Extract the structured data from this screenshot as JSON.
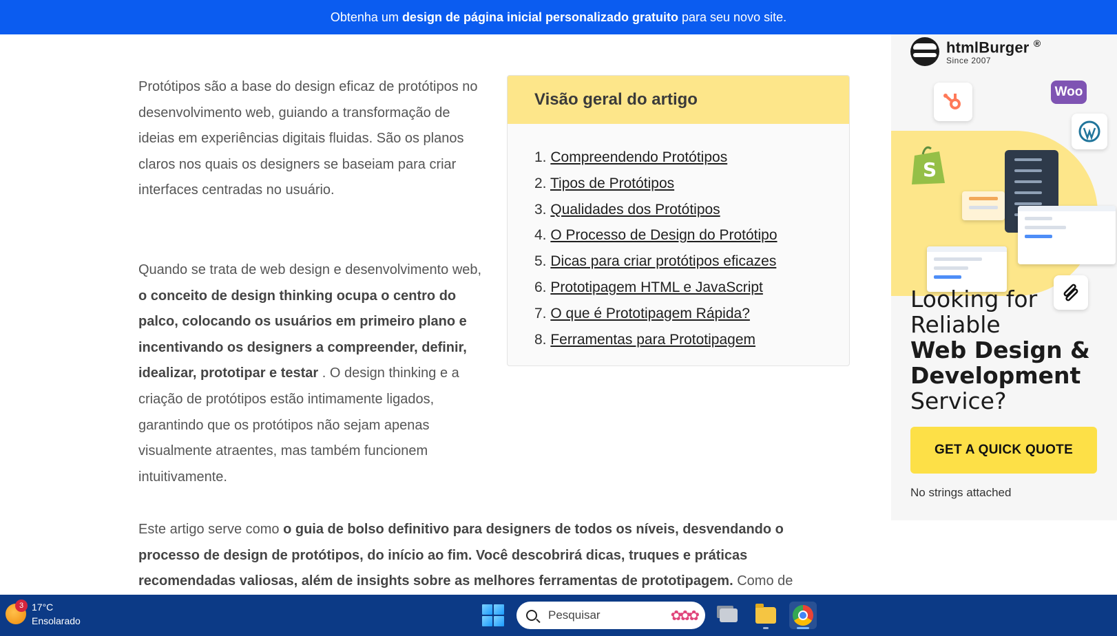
{
  "banner": {
    "prefix": "Obtenha um",
    "bold": "design de página inicial personalizado gratuito",
    "suffix": "para seu novo site."
  },
  "article": {
    "intro": "Protótipos são a base do design eficaz de protótipos no desenvolvimento web, guiando a transformação de ideias em experiências digitais fluidas. São os planos claros nos quais os designers se baseiam para criar interfaces centradas no usuário.",
    "second_start": "Quando se trata de web design e desenvolvimento web,",
    "second_bold": "o conceito de design thinking ocupa o centro do palco, colocando os usuários em primeiro plano e incentivando os designers a compreender, definir, idealizar, prototipar e testar",
    "second_end": ". O design thinking e a criação de protótipos estão intimamente ligados, garantindo que os protótipos não sejam apenas visualmente atraentes, mas também funcionem intuitivamente.",
    "third_start": "Este artigo serve como",
    "third_bold": "o guia de bolso definitivo para designers de todos os níveis, desvendando o processo de design de protótipos, do início ao fim. Você descobrirá dicas, truques e práticas recomendadas valiosas, além de insights sobre as melhores ferramentas de prototipagem.",
    "third_end": "Como de"
  },
  "overview": {
    "title": "Visão geral do artigo",
    "items": [
      {
        "num": "1.",
        "label": "Compreendendo Protótipos"
      },
      {
        "num": "2.",
        "label": "Tipos de Protótipos"
      },
      {
        "num": "3.",
        "label": "Qualidades dos Protótipos"
      },
      {
        "num": "4.",
        "label": "O Processo de Design do Protótipo"
      },
      {
        "num": "5.",
        "label": "Dicas para criar protótipos eficazes"
      },
      {
        "num": "6.",
        "label": "Prototipagem HTML e JavaScript"
      },
      {
        "num": "7.",
        "label": "O que é Prototipagem Rápida?"
      },
      {
        "num": "8.",
        "label": "Ferramentas para Prototipagem"
      }
    ]
  },
  "ad": {
    "brand": "htmlBurger",
    "registered": "®",
    "since": "Since 2007",
    "woo_label": "Woo",
    "headline_line1": "Looking for",
    "headline_line2": "Reliable",
    "headline_bold1": "Web Design &",
    "headline_bold2": "Development",
    "headline_line3": "Service?",
    "cta": "GET A QUICK QUOTE",
    "note": "No strings attached",
    "colors": {
      "accent": "#fde047",
      "blob": "#fde68a",
      "hubspot": "#ff7a59",
      "woo": "#7f54b3",
      "wordpress": "#21759b",
      "shopify": "#95bf47"
    }
  },
  "taskbar": {
    "weather_badge": "3",
    "temperature": "17°C",
    "condition": "Ensolarado",
    "search_placeholder": "Pesquisar"
  },
  "colors": {
    "banner": "#0b5cf0",
    "taskbar": "#0c3a86",
    "overview_header": "#fde68a"
  }
}
